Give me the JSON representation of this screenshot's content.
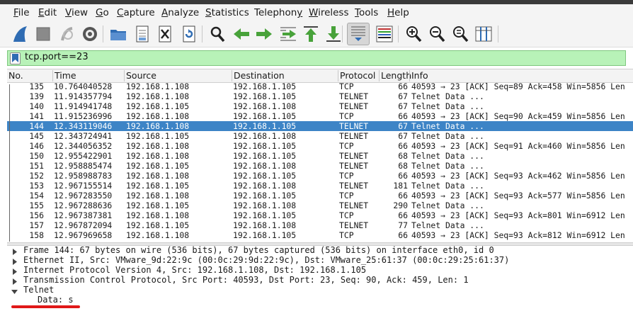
{
  "menubar": {
    "items": [
      {
        "ul": "F",
        "rest": "ile"
      },
      {
        "ul": "E",
        "rest": "dit"
      },
      {
        "ul": "V",
        "rest": "iew"
      },
      {
        "ul": "G",
        "rest": "o"
      },
      {
        "ul": "C",
        "rest": "apture"
      },
      {
        "ul": "A",
        "rest": "nalyze"
      },
      {
        "ul": "S",
        "rest": "tatistics"
      },
      {
        "ul": "",
        "pre": "Telephon",
        "ul2": "y",
        "rest": ""
      },
      {
        "ul": "W",
        "rest": "ireless"
      },
      {
        "ul": "T",
        "rest": "ools"
      },
      {
        "ul": "H",
        "rest": "elp"
      }
    ]
  },
  "toolbar": {
    "icons": [
      "shark-fin-start-icon",
      "stop-capture-icon",
      "restart-capture-icon",
      "capture-options-gear-icon",
      "open-folder-icon",
      "save-file-icon",
      "close-file-icon",
      "reload-icon",
      "find-packet-icon",
      "go-back-icon",
      "go-forward-icon",
      "go-to-packet-icon",
      "first-packet-icon",
      "last-packet-icon",
      "auto-scroll-icon",
      "colorize-icon",
      "zoom-in-icon",
      "zoom-out-icon",
      "normal-size-icon",
      "resize-columns-icon"
    ],
    "colors": {
      "accent_green": "#48a23a",
      "accent_blue": "#2f6cb3"
    }
  },
  "filter": {
    "value": "tcp.port==23",
    "bg_color": "#b8f2b8"
  },
  "packet_list": {
    "columns": [
      "No.",
      "Time",
      "Source",
      "Destination",
      "Protocol",
      "Length",
      "Info"
    ],
    "selected_no": "144",
    "rows": [
      {
        "no": "135",
        "time": "10.764040528",
        "src": "192.168.1.108",
        "dst": "192.168.1.105",
        "proto": "TCP",
        "len": "66",
        "info": "40593 → 23 [ACK] Seq=89 Ack=458 Win=5856 Len"
      },
      {
        "no": "139",
        "time": "11.914357794",
        "src": "192.168.1.108",
        "dst": "192.168.1.105",
        "proto": "TELNET",
        "len": "67",
        "info": "Telnet Data ..."
      },
      {
        "no": "140",
        "time": "11.914941748",
        "src": "192.168.1.105",
        "dst": "192.168.1.108",
        "proto": "TELNET",
        "len": "67",
        "info": "Telnet Data ..."
      },
      {
        "no": "141",
        "time": "11.915236996",
        "src": "192.168.1.108",
        "dst": "192.168.1.105",
        "proto": "TCP",
        "len": "66",
        "info": "40593 → 23 [ACK] Seq=90 Ack=459 Win=5856 Len"
      },
      {
        "no": "144",
        "time": "12.343119046",
        "src": "192.168.1.108",
        "dst": "192.168.1.105",
        "proto": "TELNET",
        "len": "67",
        "info": "Telnet Data ..."
      },
      {
        "no": "145",
        "time": "12.343724941",
        "src": "192.168.1.105",
        "dst": "192.168.1.108",
        "proto": "TELNET",
        "len": "67",
        "info": "Telnet Data ..."
      },
      {
        "no": "146",
        "time": "12.344056352",
        "src": "192.168.1.108",
        "dst": "192.168.1.105",
        "proto": "TCP",
        "len": "66",
        "info": "40593 → 23 [ACK] Seq=91 Ack=460 Win=5856 Len"
      },
      {
        "no": "150",
        "time": "12.955422901",
        "src": "192.168.1.108",
        "dst": "192.168.1.105",
        "proto": "TELNET",
        "len": "68",
        "info": "Telnet Data ..."
      },
      {
        "no": "151",
        "time": "12.958885474",
        "src": "192.168.1.105",
        "dst": "192.168.1.108",
        "proto": "TELNET",
        "len": "68",
        "info": "Telnet Data ..."
      },
      {
        "no": "152",
        "time": "12.958988783",
        "src": "192.168.1.108",
        "dst": "192.168.1.105",
        "proto": "TCP",
        "len": "66",
        "info": "40593 → 23 [ACK] Seq=93 Ack=462 Win=5856 Len"
      },
      {
        "no": "153",
        "time": "12.967155514",
        "src": "192.168.1.105",
        "dst": "192.168.1.108",
        "proto": "TELNET",
        "len": "181",
        "info": "Telnet Data ..."
      },
      {
        "no": "154",
        "time": "12.967283550",
        "src": "192.168.1.108",
        "dst": "192.168.1.105",
        "proto": "TCP",
        "len": "66",
        "info": "40593 → 23 [ACK] Seq=93 Ack=577 Win=5856 Len"
      },
      {
        "no": "155",
        "time": "12.967288636",
        "src": "192.168.1.105",
        "dst": "192.168.1.108",
        "proto": "TELNET",
        "len": "290",
        "info": "Telnet Data ..."
      },
      {
        "no": "156",
        "time": "12.967387381",
        "src": "192.168.1.108",
        "dst": "192.168.1.105",
        "proto": "TCP",
        "len": "66",
        "info": "40593 → 23 [ACK] Seq=93 Ack=801 Win=6912 Len"
      },
      {
        "no": "157",
        "time": "12.967872094",
        "src": "192.168.1.105",
        "dst": "192.168.1.108",
        "proto": "TELNET",
        "len": "77",
        "info": "Telnet Data ..."
      },
      {
        "no": "158",
        "time": "12.967969658",
        "src": "192.168.1.108",
        "dst": "192.168.1.105",
        "proto": "TCP",
        "len": "66",
        "info": "40593 → 23 [ACK] Seq=93 Ack=812 Win=6912 Len"
      }
    ],
    "selected_color": "#3d84c6"
  },
  "details": {
    "items": [
      {
        "text": "Frame 144: 67 bytes on wire (536 bits), 67 bytes captured (536 bits) on interface eth0, id 0",
        "expanded": false
      },
      {
        "text": "Ethernet II, Src: VMware_9d:22:9c (00:0c:29:9d:22:9c), Dst: VMware_25:61:37 (00:0c:29:25:61:37)",
        "expanded": false
      },
      {
        "text": "Internet Protocol Version 4, Src: 192.168.1.108, Dst: 192.168.1.105",
        "expanded": false
      },
      {
        "text": "Transmission Control Protocol, Src Port: 40593, Dst Port: 23, Seq: 90, Ack: 459, Len: 1",
        "expanded": false
      },
      {
        "text": "Telnet",
        "expanded": true
      }
    ],
    "child": "Data: s",
    "annotation_color": "#e01818"
  }
}
